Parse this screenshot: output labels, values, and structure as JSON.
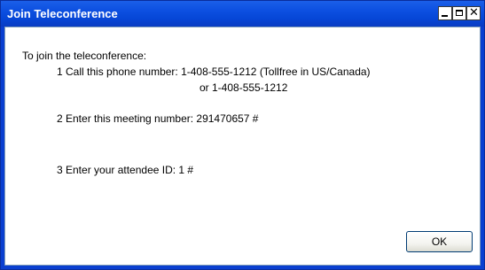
{
  "window": {
    "title": "Join Teleconference",
    "controls": {
      "minimize": "minimize",
      "maximize": "maximize",
      "close": "close"
    }
  },
  "content": {
    "intro": "To join the teleconference:",
    "step1_line1": "1  Call this phone number: 1-408-555-1212 (Tollfree in US/Canada)",
    "step1_line2": "or 1-408-555-1212",
    "step2": "2  Enter this meeting number: 291470657 #",
    "step3": "3  Enter your attendee ID: 1 #"
  },
  "buttons": {
    "ok": "OK"
  },
  "icons": {
    "minimize": "minimize-icon",
    "maximize": "maximize-icon",
    "close": "close-icon"
  },
  "colors": {
    "titlebar": "#0a4fd8",
    "window_border": "#0a2d9c",
    "background": "#ffffff"
  }
}
